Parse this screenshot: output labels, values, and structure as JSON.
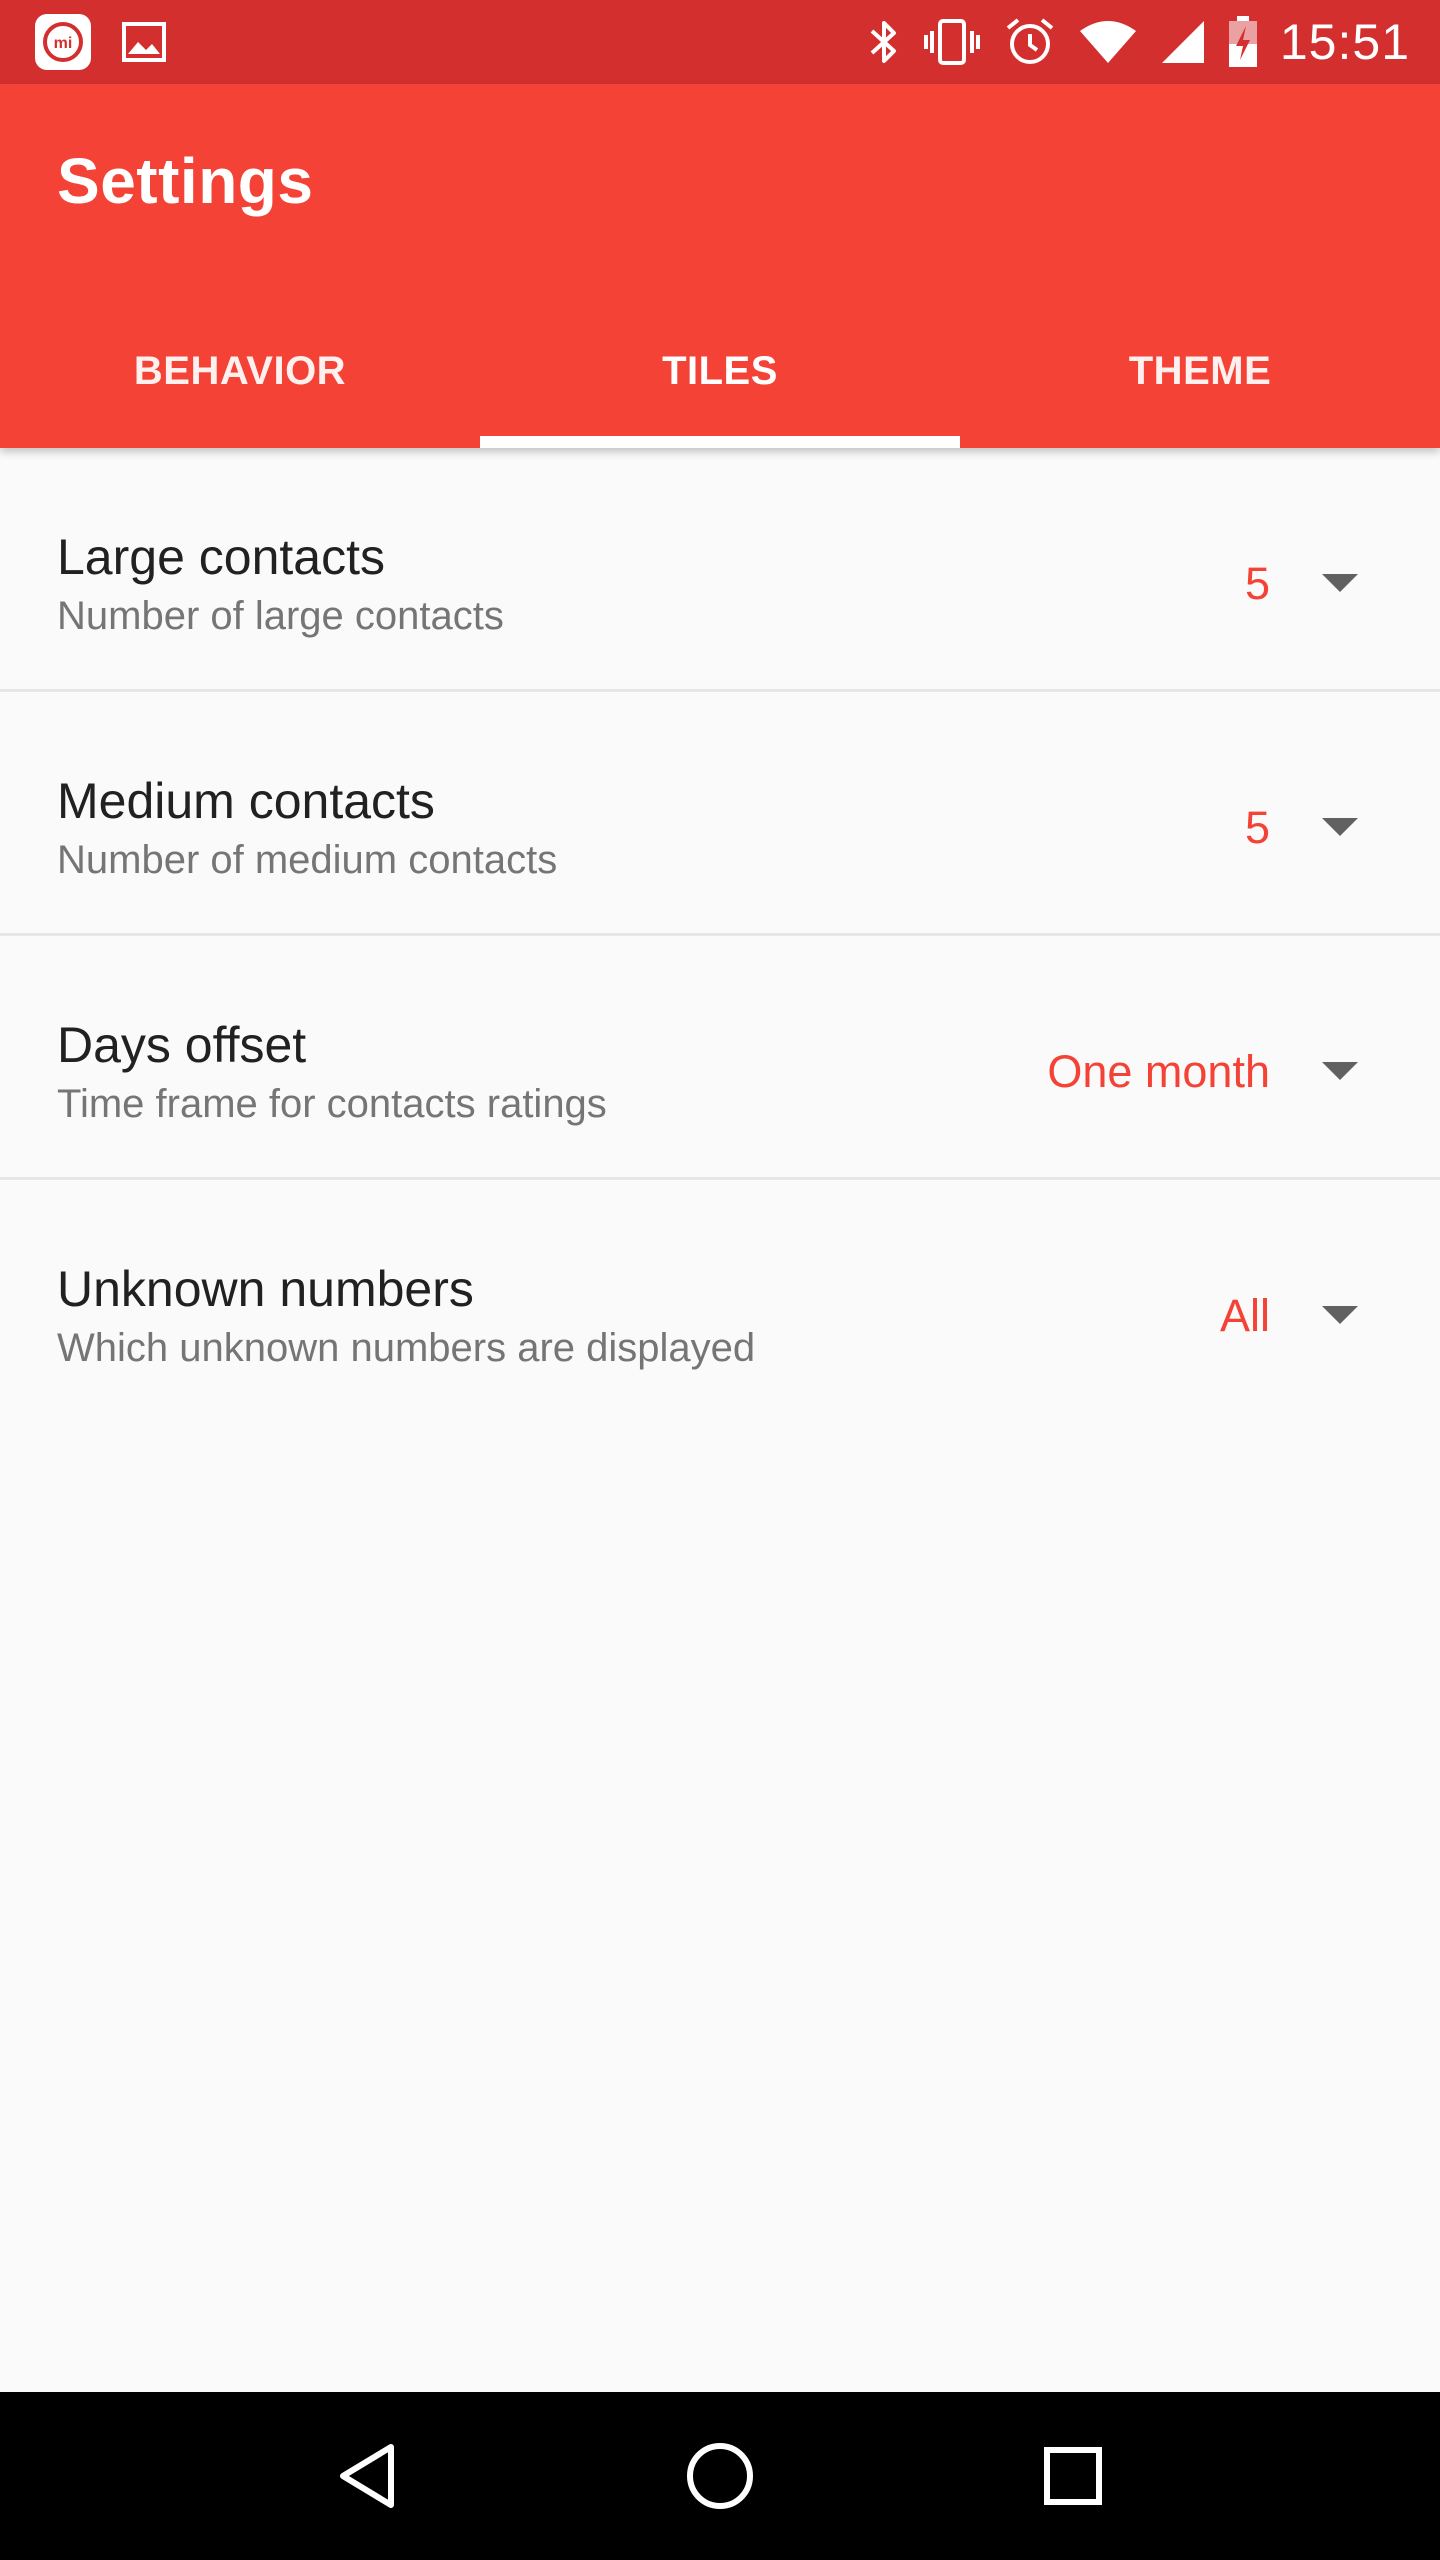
{
  "status_bar": {
    "time": "15:51",
    "left_icons": [
      "mi-app-icon",
      "image-icon"
    ],
    "right_icons": [
      "bluetooth-icon",
      "vibrate-icon",
      "alarm-icon",
      "wifi-icon",
      "signal-icon",
      "battery-charging-icon"
    ],
    "mi_label": "mi"
  },
  "app_bar": {
    "title": "Settings",
    "color": "#f44336"
  },
  "tabs": [
    {
      "label": "BEHAVIOR",
      "active": false
    },
    {
      "label": "TILES",
      "active": true
    },
    {
      "label": "THEME",
      "active": false
    }
  ],
  "settings": [
    {
      "title": "Large contacts",
      "subtitle": "Number of large contacts",
      "value": "5"
    },
    {
      "title": "Medium contacts",
      "subtitle": "Number of medium contacts",
      "value": "5"
    },
    {
      "title": "Days offset",
      "subtitle": "Time frame for contacts ratings",
      "value": "One month"
    },
    {
      "title": "Unknown numbers",
      "subtitle": "Which unknown numbers are displayed",
      "value": "All"
    }
  ],
  "nav_bar": {
    "buttons": [
      "back-icon",
      "home-icon",
      "recents-icon"
    ]
  },
  "colors": {
    "status_bar": "#d32f2f",
    "accent": "#f44336",
    "background": "#fafafa"
  }
}
